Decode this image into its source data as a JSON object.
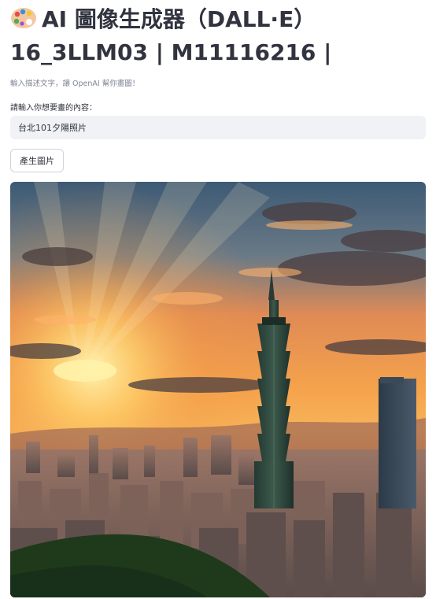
{
  "header": {
    "title": "AI 圖像生成器（DALL·E）16_3LLM03 | M11116216 |",
    "icon": "artist-palette-icon"
  },
  "caption": "輸入描述文字，讓 OpenAI 幫你畫圖！",
  "prompt_input": {
    "label": "請輸入你想要畫的內容：",
    "value": "台北101夕陽照片"
  },
  "generate_button": {
    "label": "產生圖片"
  },
  "generated_image": {
    "subject": "Taipei 101 at sunset over the city skyline",
    "colors": {
      "sky_top": "#3d5a75",
      "sky_glow": "#f7a24a",
      "sun": "#ffe58a",
      "city": "#6a5a55",
      "foreground": "#1f3a1a"
    }
  },
  "theme": {
    "text": "#31333f",
    "muted": "#808495",
    "input_bg": "#f0f2f6",
    "border": "#d0d3da"
  }
}
